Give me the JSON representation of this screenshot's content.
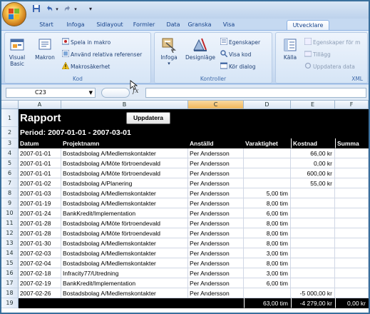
{
  "qat": {
    "save_icon": "floppy-icon",
    "undo_icon": "undo-icon",
    "redo_icon": "redo-icon",
    "customize_icon": "chevron-down-icon"
  },
  "tabs": [
    "Start",
    "Infoga",
    "Sidlayout",
    "Formler",
    "Data",
    "Granska",
    "Visa",
    "Utvecklare"
  ],
  "active_tab": "Utvecklare",
  "ribbon": {
    "kod": {
      "label": "Kod",
      "visual_basic": "Visual Basic",
      "makron": "Makron",
      "spela_in": "Spela in makro",
      "relativa": "Använd relativa referenser",
      "sakerhet": "Makrosäkerhet"
    },
    "kontroller": {
      "label": "Kontroller",
      "infoga": "Infoga",
      "designlage": "Designläge",
      "egenskaper": "Egenskaper",
      "visa_kod": "Visa kod",
      "kor_dialog": "Kör dialog"
    },
    "xml": {
      "label": "XML",
      "kalla": "Källa",
      "egenskaper_for": "Egenskaper för m",
      "tillagg": "Tillägg",
      "uppdatera_data": "Uppdatera data"
    }
  },
  "formula_bar": {
    "name_box": "C23",
    "fx": "fx",
    "formula": ""
  },
  "columns": [
    "A",
    "B",
    "C",
    "D",
    "E",
    "F"
  ],
  "selected_column": "C",
  "sheet": {
    "title": "Rapport",
    "update_button": "Uppdatera",
    "period": "Period: 2007-01-01 - 2007-03-01",
    "headers": [
      "Datum",
      "Projektnamn",
      "Anställd",
      "Varaktighet",
      "Kostnad",
      "Summa"
    ],
    "rows": [
      {
        "n": "4",
        "a": "2007-01-01",
        "b": "Bostadsbolag A/Medlemskontakter",
        "c": "Per Andersson",
        "d": "",
        "e": "66,00 kr"
      },
      {
        "n": "5",
        "a": "2007-01-01",
        "b": "Bostadsbolag A/Möte förtroendevald",
        "c": "Per Andersson",
        "d": "",
        "e": "0,00 kr"
      },
      {
        "n": "6",
        "a": "2007-01-01",
        "b": "Bostadsbolag A/Möte förtroendevald",
        "c": "Per Andersson",
        "d": "",
        "e": "600,00 kr"
      },
      {
        "n": "7",
        "a": "2007-01-02",
        "b": "Bostadsbolag A/Planering",
        "c": "Per Andersson",
        "d": "",
        "e": "55,00 kr"
      },
      {
        "n": "8",
        "a": "2007-01-03",
        "b": "Bostadsbolag A/Medlemskontakter",
        "c": "Per Andersson",
        "d": "5,00 tim",
        "e": ""
      },
      {
        "n": "9",
        "a": "2007-01-19",
        "b": "Bostadsbolag A/Medlemskontakter",
        "c": "Per Andersson",
        "d": "8,00 tim",
        "e": ""
      },
      {
        "n": "10",
        "a": "2007-01-24",
        "b": "BankKredit/Implementation",
        "c": "Per Andersson",
        "d": "6,00 tim",
        "e": ""
      },
      {
        "n": "11",
        "a": "2007-01-28",
        "b": "Bostadsbolag A/Möte förtroendevald",
        "c": "Per Andersson",
        "d": "8,00 tim",
        "e": ""
      },
      {
        "n": "12",
        "a": "2007-01-28",
        "b": "Bostadsbolag A/Möte förtroendevald",
        "c": "Per Andersson",
        "d": "8,00 tim",
        "e": ""
      },
      {
        "n": "13",
        "a": "2007-01-30",
        "b": "Bostadsbolag A/Medlemskontakter",
        "c": "Per Andersson",
        "d": "8,00 tim",
        "e": ""
      },
      {
        "n": "14",
        "a": "2007-02-03",
        "b": "Bostadsbolag A/Medlemskontakter",
        "c": "Per Andersson",
        "d": "3,00 tim",
        "e": ""
      },
      {
        "n": "15",
        "a": "2007-02-04",
        "b": "Bostadsbolag A/Medlemskontakter",
        "c": "Per Andersson",
        "d": "8,00 tim",
        "e": ""
      },
      {
        "n": "16",
        "a": "2007-02-18",
        "b": "Infracity77/Utredning",
        "c": "Per Andersson",
        "d": "3,00 tim",
        "e": ""
      },
      {
        "n": "17",
        "a": "2007-02-19",
        "b": "BankKredit/Implementation",
        "c": "Per Andersson",
        "d": "6,00 tim",
        "e": ""
      },
      {
        "n": "18",
        "a": "2007-02-26",
        "b": "Bostadsbolag A/Medlemskontakter",
        "c": "Per Andersson",
        "d": "",
        "e": "-5 000,00 kr"
      }
    ],
    "totals": {
      "n": "19",
      "d": "63,00 tim",
      "e": "-4 279,00 kr",
      "f": "0,00 kr"
    }
  }
}
